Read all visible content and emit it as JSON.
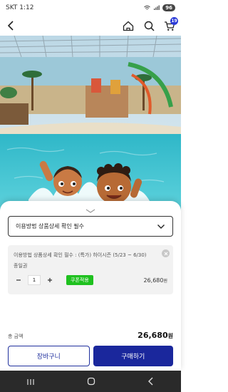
{
  "status_bar": {
    "time": "SKT 1:12",
    "battery": "96"
  },
  "nav": {
    "cart_count": "19"
  },
  "sheet": {
    "option_select_label": "이용방법 상품상세 확인 필수",
    "item": {
      "title": "이용방법 상품상세 확인 필수 : (특가) 하이시즌 (5/23 ~ 6/30)",
      "subtitle": "종일권",
      "quantity": "1",
      "coupon_label": "쿠폰적용",
      "price": "26,680",
      "price_unit": "원"
    },
    "total": {
      "label": "총 금액",
      "value": "26,680",
      "unit": "원"
    },
    "buttons": {
      "cart_label": "장바구니",
      "buy_label": "구매하기"
    }
  },
  "colors": {
    "brand_blue": "#1a279c",
    "coupon_green": "#1fc11f",
    "cart_badge": "#2b3bd8"
  }
}
